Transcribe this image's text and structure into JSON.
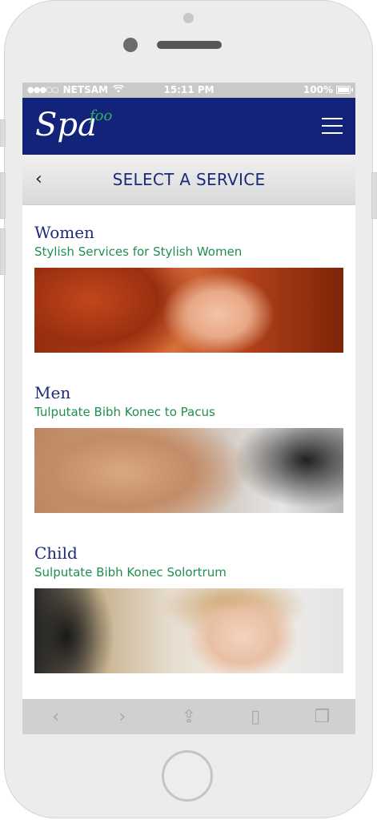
{
  "status_bar": {
    "carrier": "NETSAM",
    "time": "15:11 PM",
    "battery": "100%",
    "signal_icon": "signal-dots-icon",
    "wifi_icon": "wifi-icon",
    "battery_icon": "battery-icon"
  },
  "app_bar": {
    "logo_main": "Spa",
    "logo_sub": "foo",
    "menu_icon": "hamburger-menu-icon",
    "colors": {
      "background": "#13237a",
      "logo_accent": "#2fb35a"
    }
  },
  "subheader": {
    "back_symbol": "‹",
    "title": "SELECT A SERVICE"
  },
  "services": [
    {
      "name": "Women",
      "description": "Stylish Services for Stylish Women",
      "image": "woman-red-hair-photo"
    },
    {
      "name": "Men",
      "description": "Tulputate Bibh Konec to Pacus",
      "image": "smiling-man-photo"
    },
    {
      "name": "Child",
      "description": "Sulputate Bibh Konec Solortrum",
      "image": "child-haircut-photo"
    }
  ],
  "browser_toolbar": {
    "back": "‹",
    "forward": "›",
    "share": "⇪",
    "bookmarks": "▯",
    "tabs": "❐"
  },
  "colors": {
    "title_blue": "#1d2a7a",
    "subtitle_green": "#1f8f4f"
  }
}
